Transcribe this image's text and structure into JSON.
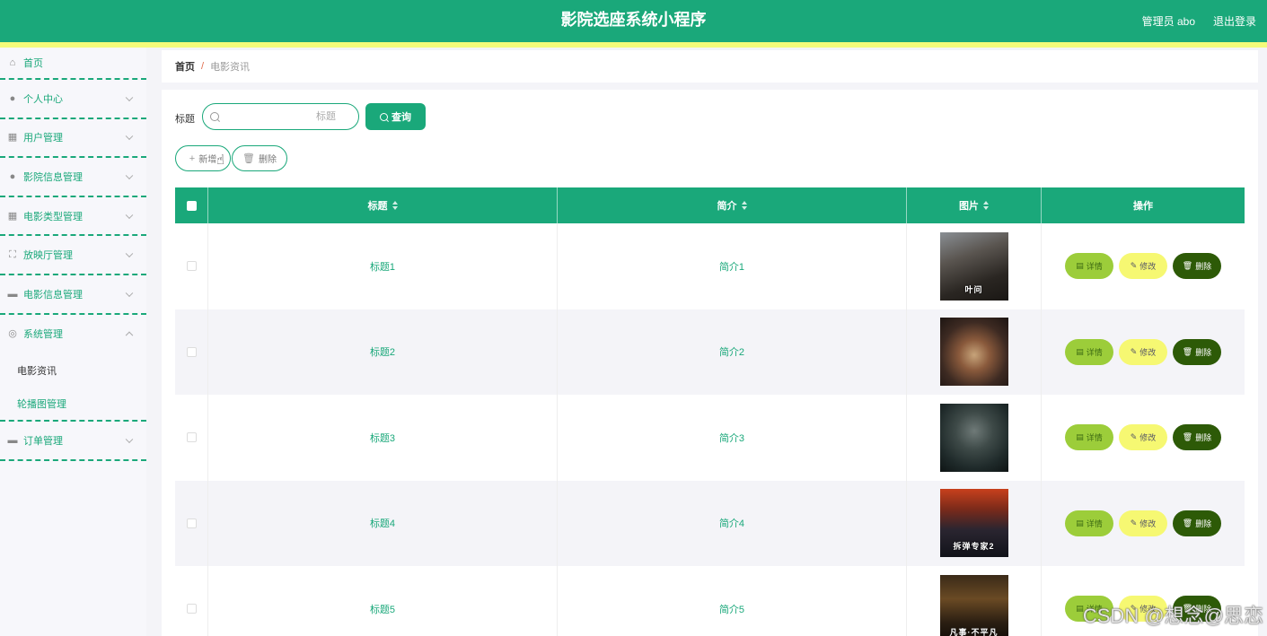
{
  "header": {
    "title": "影院选座系统小程序",
    "admin_label": "管理员 abo",
    "logout_label": "退出登录"
  },
  "sidebar": {
    "items": [
      {
        "label": "首页",
        "icon": "home-icon"
      },
      {
        "label": "个人中心",
        "icon": "user-icon"
      },
      {
        "label": "用户管理",
        "icon": "chart-icon"
      },
      {
        "label": "影院信息管理",
        "icon": "user-icon"
      },
      {
        "label": "电影类型管理",
        "icon": "grid-icon"
      },
      {
        "label": "放映厅管理",
        "icon": "frame-icon"
      },
      {
        "label": "电影信息管理",
        "icon": "briefcase-icon"
      },
      {
        "label": "系统管理",
        "icon": "settings-icon"
      },
      {
        "label": "订单管理",
        "icon": "briefcase-icon"
      }
    ],
    "submenu": [
      {
        "label": "电影资讯"
      },
      {
        "label": "轮播图管理"
      }
    ]
  },
  "breadcrumb": {
    "home": "首页",
    "separator": "/",
    "current": "电影资讯"
  },
  "search": {
    "label": "标题",
    "placeholder": "标题",
    "query_label": "查询"
  },
  "actions": {
    "add_label": "新增",
    "delete_label": "删除"
  },
  "table": {
    "headers": [
      "标题",
      "简介",
      "图片",
      "操作"
    ],
    "rows": [
      {
        "title": "标题1",
        "intro": "简介1",
        "poster_text": "叶问"
      },
      {
        "title": "标题2",
        "intro": "简介2",
        "poster_text": ""
      },
      {
        "title": "标题3",
        "intro": "简介3",
        "poster_text": ""
      },
      {
        "title": "标题4",
        "intro": "简介4",
        "poster_text": "拆弹专家2"
      },
      {
        "title": "标题5",
        "intro": "简介5",
        "poster_text": "凡事·不平凡"
      }
    ],
    "ops": {
      "detail": "详情",
      "edit": "修改",
      "delete": "删除"
    }
  },
  "watermark": "CSDN @想念@思恋",
  "colors": {
    "primary": "#1aa87a",
    "stripe": "#f4fb7a",
    "detail_btn": "#9ccd3a",
    "edit_btn": "#f6f872",
    "delete_btn": "#2d5a07"
  }
}
